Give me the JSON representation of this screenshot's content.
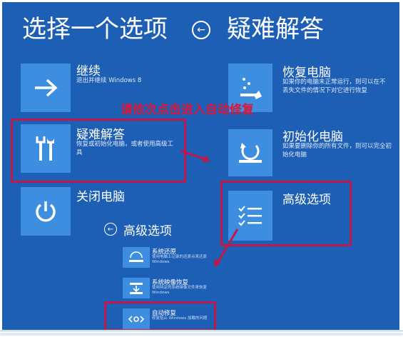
{
  "left_panel": {
    "title": "选择一个选项",
    "options": [
      {
        "title": "继续",
        "desc": "退出并继续 Windows 8"
      },
      {
        "title": "疑难解答",
        "desc": "恢复或初始化电脑，或者使用高级工具"
      },
      {
        "title": "关闭电脑",
        "desc": ""
      }
    ]
  },
  "right_panel": {
    "title": "疑难解答",
    "options": [
      {
        "title": "恢复电脑",
        "desc": "如果你的电脑未正常运行，则可以在不丢失文件的情况下对它进行恢复"
      },
      {
        "title": "初始化电脑",
        "desc": "如果要删除你的所有文件，则可以完全初始化电脑"
      },
      {
        "title": "高级选项",
        "desc": ""
      }
    ]
  },
  "annotation": "请依次点击进入自动修复",
  "advanced_panel": {
    "title": "高级选项",
    "options": [
      {
        "title": "系统还原",
        "desc": "使用电脑上记录的还原点来还原 Windows"
      },
      {
        "title": "系统映像恢复",
        "desc": "使用特定的系统映像文件来恢复 Windows"
      },
      {
        "title": "自动修复",
        "desc": "修复阻止 Windows 加载的问题"
      }
    ]
  },
  "colors": {
    "background": "#1e5fb6",
    "tile": "#3d8de0",
    "highlight": "#c1184a",
    "annotation": "#d8183b"
  }
}
